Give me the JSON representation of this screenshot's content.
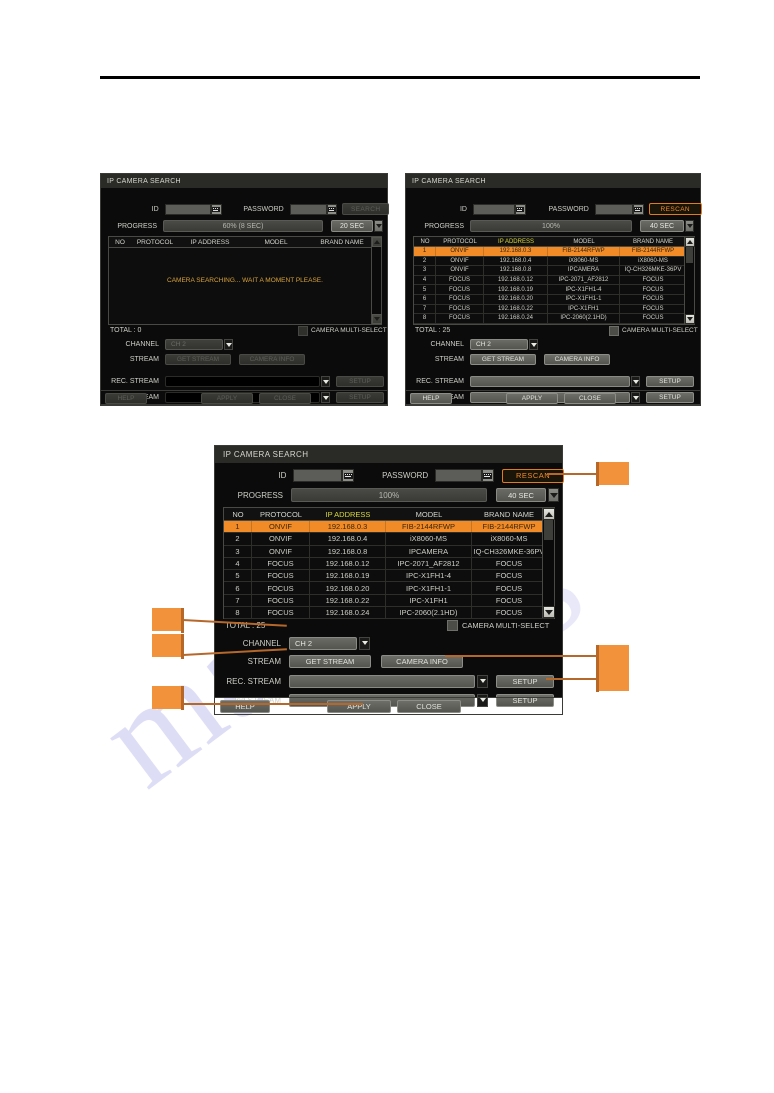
{
  "document": {
    "watermark_text_left": "man",
    "watermark_text_right": "ls"
  },
  "dialog_searching": {
    "title": "IP CAMERA SEARCH",
    "fields": {
      "id_label": "ID",
      "id_value": "",
      "password_label": "PASSWORD",
      "password_value": "",
      "search_button": "SEARCH",
      "progress_label": "PROGRESS",
      "progress_value": "60% (8 SEC)",
      "timeout_value": "20 SEC"
    },
    "table": {
      "columns": [
        "NO",
        "PROTOCOL",
        "IP ADDRESS",
        "MODEL",
        "BRAND NAME"
      ],
      "rows": [],
      "empty_message": "CAMERA SEARCHING... WAIT A MOMENT PLEASE."
    },
    "total_label": "TOTAL : 0",
    "multi_select_label": "CAMERA MULTI-SELECT",
    "channel_label": "CHANNEL",
    "channel_value": "CH 2",
    "stream_label": "STREAM",
    "get_stream_button": "GET STREAM",
    "camera_info_button": "CAMERA INFO",
    "rec_stream_label": "REC. STREAM",
    "rec_stream_value": "",
    "rec_setup_button": "SETUP",
    "second_stream_label": "2nd STREAM",
    "second_stream_value": "",
    "second_setup_button": "SETUP",
    "help_button": "HELP",
    "apply_button": "APPLY",
    "close_button": "CLOSE"
  },
  "dialog_results": {
    "title": "IP CAMERA SEARCH",
    "fields": {
      "id_label": "ID",
      "id_value": "",
      "password_label": "PASSWORD",
      "password_value": "",
      "search_button": "RESCAN",
      "progress_label": "PROGRESS",
      "progress_value": "100%",
      "timeout_value": "40 SEC"
    },
    "table": {
      "columns": [
        "NO",
        "PROTOCOL",
        "IP ADDRESS",
        "MODEL",
        "BRAND NAME"
      ],
      "rows": [
        {
          "no": "1",
          "protocol": "ONVIF",
          "ip": "192.168.0.3",
          "model": "FIB-2144RFWP",
          "brand": "FIB-2144RFWP",
          "selected": true
        },
        {
          "no": "2",
          "protocol": "ONVIF",
          "ip": "192.168.0.4",
          "model": "iX8060-MS",
          "brand": "iX8060-MS",
          "selected": false
        },
        {
          "no": "3",
          "protocol": "ONVIF",
          "ip": "192.168.0.8",
          "model": "IPCAMERA",
          "brand": "IQ-CH326MKE-36PV",
          "selected": false
        },
        {
          "no": "4",
          "protocol": "FOCUS",
          "ip": "192.168.0.12",
          "model": "IPC-2071_AF2812",
          "brand": "FOCUS",
          "selected": false
        },
        {
          "no": "5",
          "protocol": "FOCUS",
          "ip": "192.168.0.19",
          "model": "IPC-X1FH1-4",
          "brand": "FOCUS",
          "selected": false
        },
        {
          "no": "6",
          "protocol": "FOCUS",
          "ip": "192.168.0.20",
          "model": "IPC-X1FH1-1",
          "brand": "FOCUS",
          "selected": false
        },
        {
          "no": "7",
          "protocol": "FOCUS",
          "ip": "192.168.0.22",
          "model": "IPC-X1FH1",
          "brand": "FOCUS",
          "selected": false
        },
        {
          "no": "8",
          "protocol": "FOCUS",
          "ip": "192.168.0.24",
          "model": "IPC-2060(2.1HD)",
          "brand": "FOCUS",
          "selected": false
        }
      ],
      "empty_message": ""
    },
    "total_label": "TOTAL : 25",
    "multi_select_label": "CAMERA MULTI-SELECT",
    "channel_label": "CHANNEL",
    "channel_value": "CH 2",
    "stream_label": "STREAM",
    "get_stream_button": "GET STREAM",
    "camera_info_button": "CAMERA INFO",
    "rec_stream_label": "REC. STREAM",
    "rec_stream_value": "",
    "rec_setup_button": "SETUP",
    "second_stream_label": "2nd STREAM",
    "second_stream_value": "",
    "second_setup_button": "SETUP",
    "help_button": "HELP",
    "apply_button": "APPLY",
    "close_button": "CLOSE"
  },
  "dialog_annotated": {
    "title": "IP CAMERA SEARCH",
    "fields": {
      "id_label": "ID",
      "id_value": "",
      "password_label": "PASSWORD",
      "password_value": "",
      "search_button": "RESCAN",
      "progress_label": "PROGRESS",
      "progress_value": "100%",
      "timeout_value": "40 SEC"
    },
    "table": {
      "columns": [
        "NO",
        "PROTOCOL",
        "IP ADDRESS",
        "MODEL",
        "BRAND NAME"
      ],
      "rows": [
        {
          "no": "1",
          "protocol": "ONVIF",
          "ip": "192.168.0.3",
          "model": "FIB-2144RFWP",
          "brand": "FIB-2144RFWP",
          "selected": true
        },
        {
          "no": "2",
          "protocol": "ONVIF",
          "ip": "192.168.0.4",
          "model": "iX8060-MS",
          "brand": "iX8060-MS",
          "selected": false
        },
        {
          "no": "3",
          "protocol": "ONVIF",
          "ip": "192.168.0.8",
          "model": "IPCAMERA",
          "brand": "IQ-CH326MKE-36PV",
          "selected": false
        },
        {
          "no": "4",
          "protocol": "FOCUS",
          "ip": "192.168.0.12",
          "model": "IPC-2071_AF2812",
          "brand": "FOCUS",
          "selected": false
        },
        {
          "no": "5",
          "protocol": "FOCUS",
          "ip": "192.168.0.19",
          "model": "IPC-X1FH1-4",
          "brand": "FOCUS",
          "selected": false
        },
        {
          "no": "6",
          "protocol": "FOCUS",
          "ip": "192.168.0.20",
          "model": "IPC-X1FH1-1",
          "brand": "FOCUS",
          "selected": false
        },
        {
          "no": "7",
          "protocol": "FOCUS",
          "ip": "192.168.0.22",
          "model": "IPC-X1FH1",
          "brand": "FOCUS",
          "selected": false
        },
        {
          "no": "8",
          "protocol": "FOCUS",
          "ip": "192.168.0.24",
          "model": "IPC-2060(2.1HD)",
          "brand": "FOCUS",
          "selected": false
        }
      ],
      "empty_message": ""
    },
    "total_label": "TOTAL : 25",
    "multi_select_label": "CAMERA MULTI-SELECT",
    "channel_label": "CHANNEL",
    "channel_value": "CH 2",
    "stream_label": "STREAM",
    "get_stream_button": "GET STREAM",
    "camera_info_button": "CAMERA INFO",
    "rec_stream_label": "REC. STREAM",
    "rec_stream_value": "",
    "rec_setup_button": "SETUP",
    "second_stream_label": "2nd STREAM",
    "second_stream_value": "",
    "second_setup_button": "SETUP",
    "help_button": "HELP",
    "apply_button": "APPLY",
    "close_button": "CLOSE"
  },
  "callouts": {
    "accent_color": "#f2933c",
    "leader_color": "#b5682a",
    "markers": [
      {
        "id": "rescan",
        "label": ""
      },
      {
        "id": "channel",
        "label": ""
      },
      {
        "id": "get-stream",
        "label": ""
      },
      {
        "id": "camera-info",
        "label": ""
      },
      {
        "id": "setup",
        "label": ""
      },
      {
        "id": "apply",
        "label": ""
      }
    ]
  }
}
